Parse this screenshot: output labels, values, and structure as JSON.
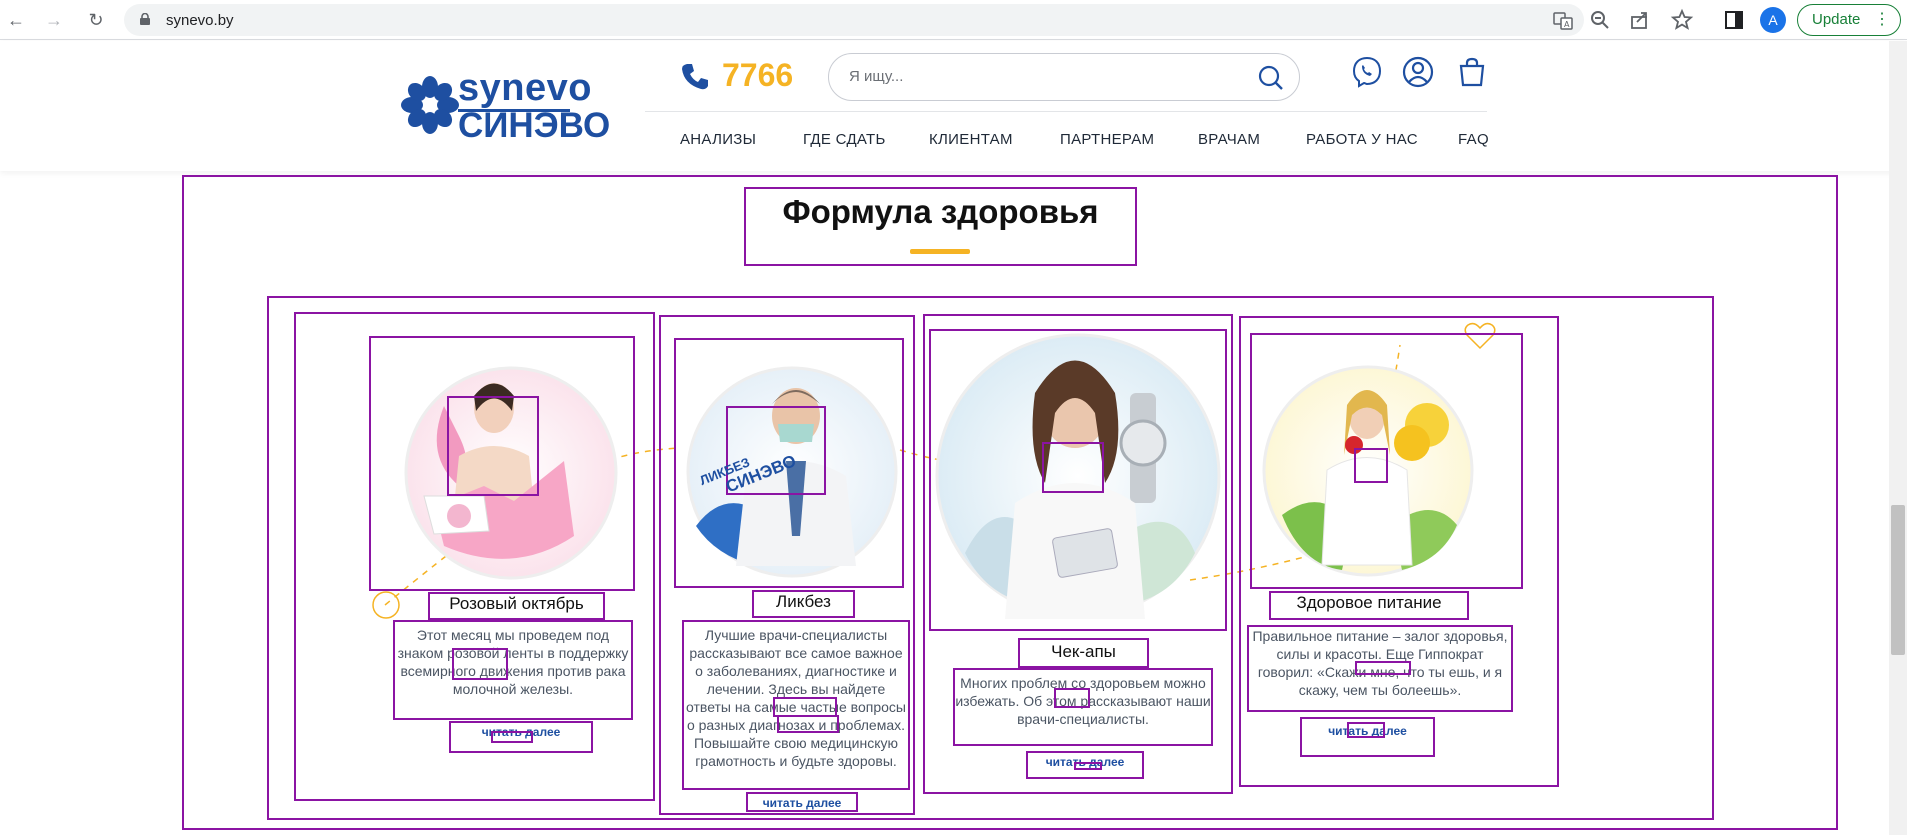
{
  "browser": {
    "url": "synevo.by",
    "avatar_initial": "A",
    "update_label": "Update"
  },
  "header": {
    "logo_line1": "synevo",
    "logo_line2": "СИНЭВО",
    "phone": "7766",
    "search_placeholder": "Я ищу...",
    "menu": [
      "АНАЛИЗЫ",
      "ГДЕ СДАТЬ",
      "КЛИЕНТАМ",
      "ПАРТНЕРАМ",
      "ВРАЧАМ",
      "РАБОТА У НАС",
      "FAQ"
    ]
  },
  "section": {
    "title": "Формула здоровья",
    "accent_color": "#f5b324",
    "cards": [
      {
        "title": "Розовый октябрь",
        "text": "Этот месяц мы проведем под знаком розовой ленты в поддержку всемирного движения против рака молочной железы.",
        "link": "читать далее"
      },
      {
        "title": "Ликбез",
        "text": "Лучшие врачи-специалисты рассказывают все самое важное о заболеваниях, диагностике и лечении. Здесь вы найдете ответы на самые частые вопросы о разных диагнозах и проблемах. Повышайте свою медицинскую грамотность и будьте здоровы.",
        "link": "читать далее",
        "badge_line1": "ЛИКБЕЗ",
        "badge_line2": "СИНЭВО"
      },
      {
        "title": "Чек-апы",
        "text": "Многих проблем со здоровьем можно избежать. Об этом рассказывают наши врачи-специалисты.",
        "link": "читать далее"
      },
      {
        "title": "Здоровое питание",
        "text": "Правильное питание – залог здоровья, силы и красоты. Еще Гиппократ говорил: «Скажи мне, что ты ешь, и я скажу, чем ты болеешь».",
        "link": "читать далее"
      }
    ]
  }
}
